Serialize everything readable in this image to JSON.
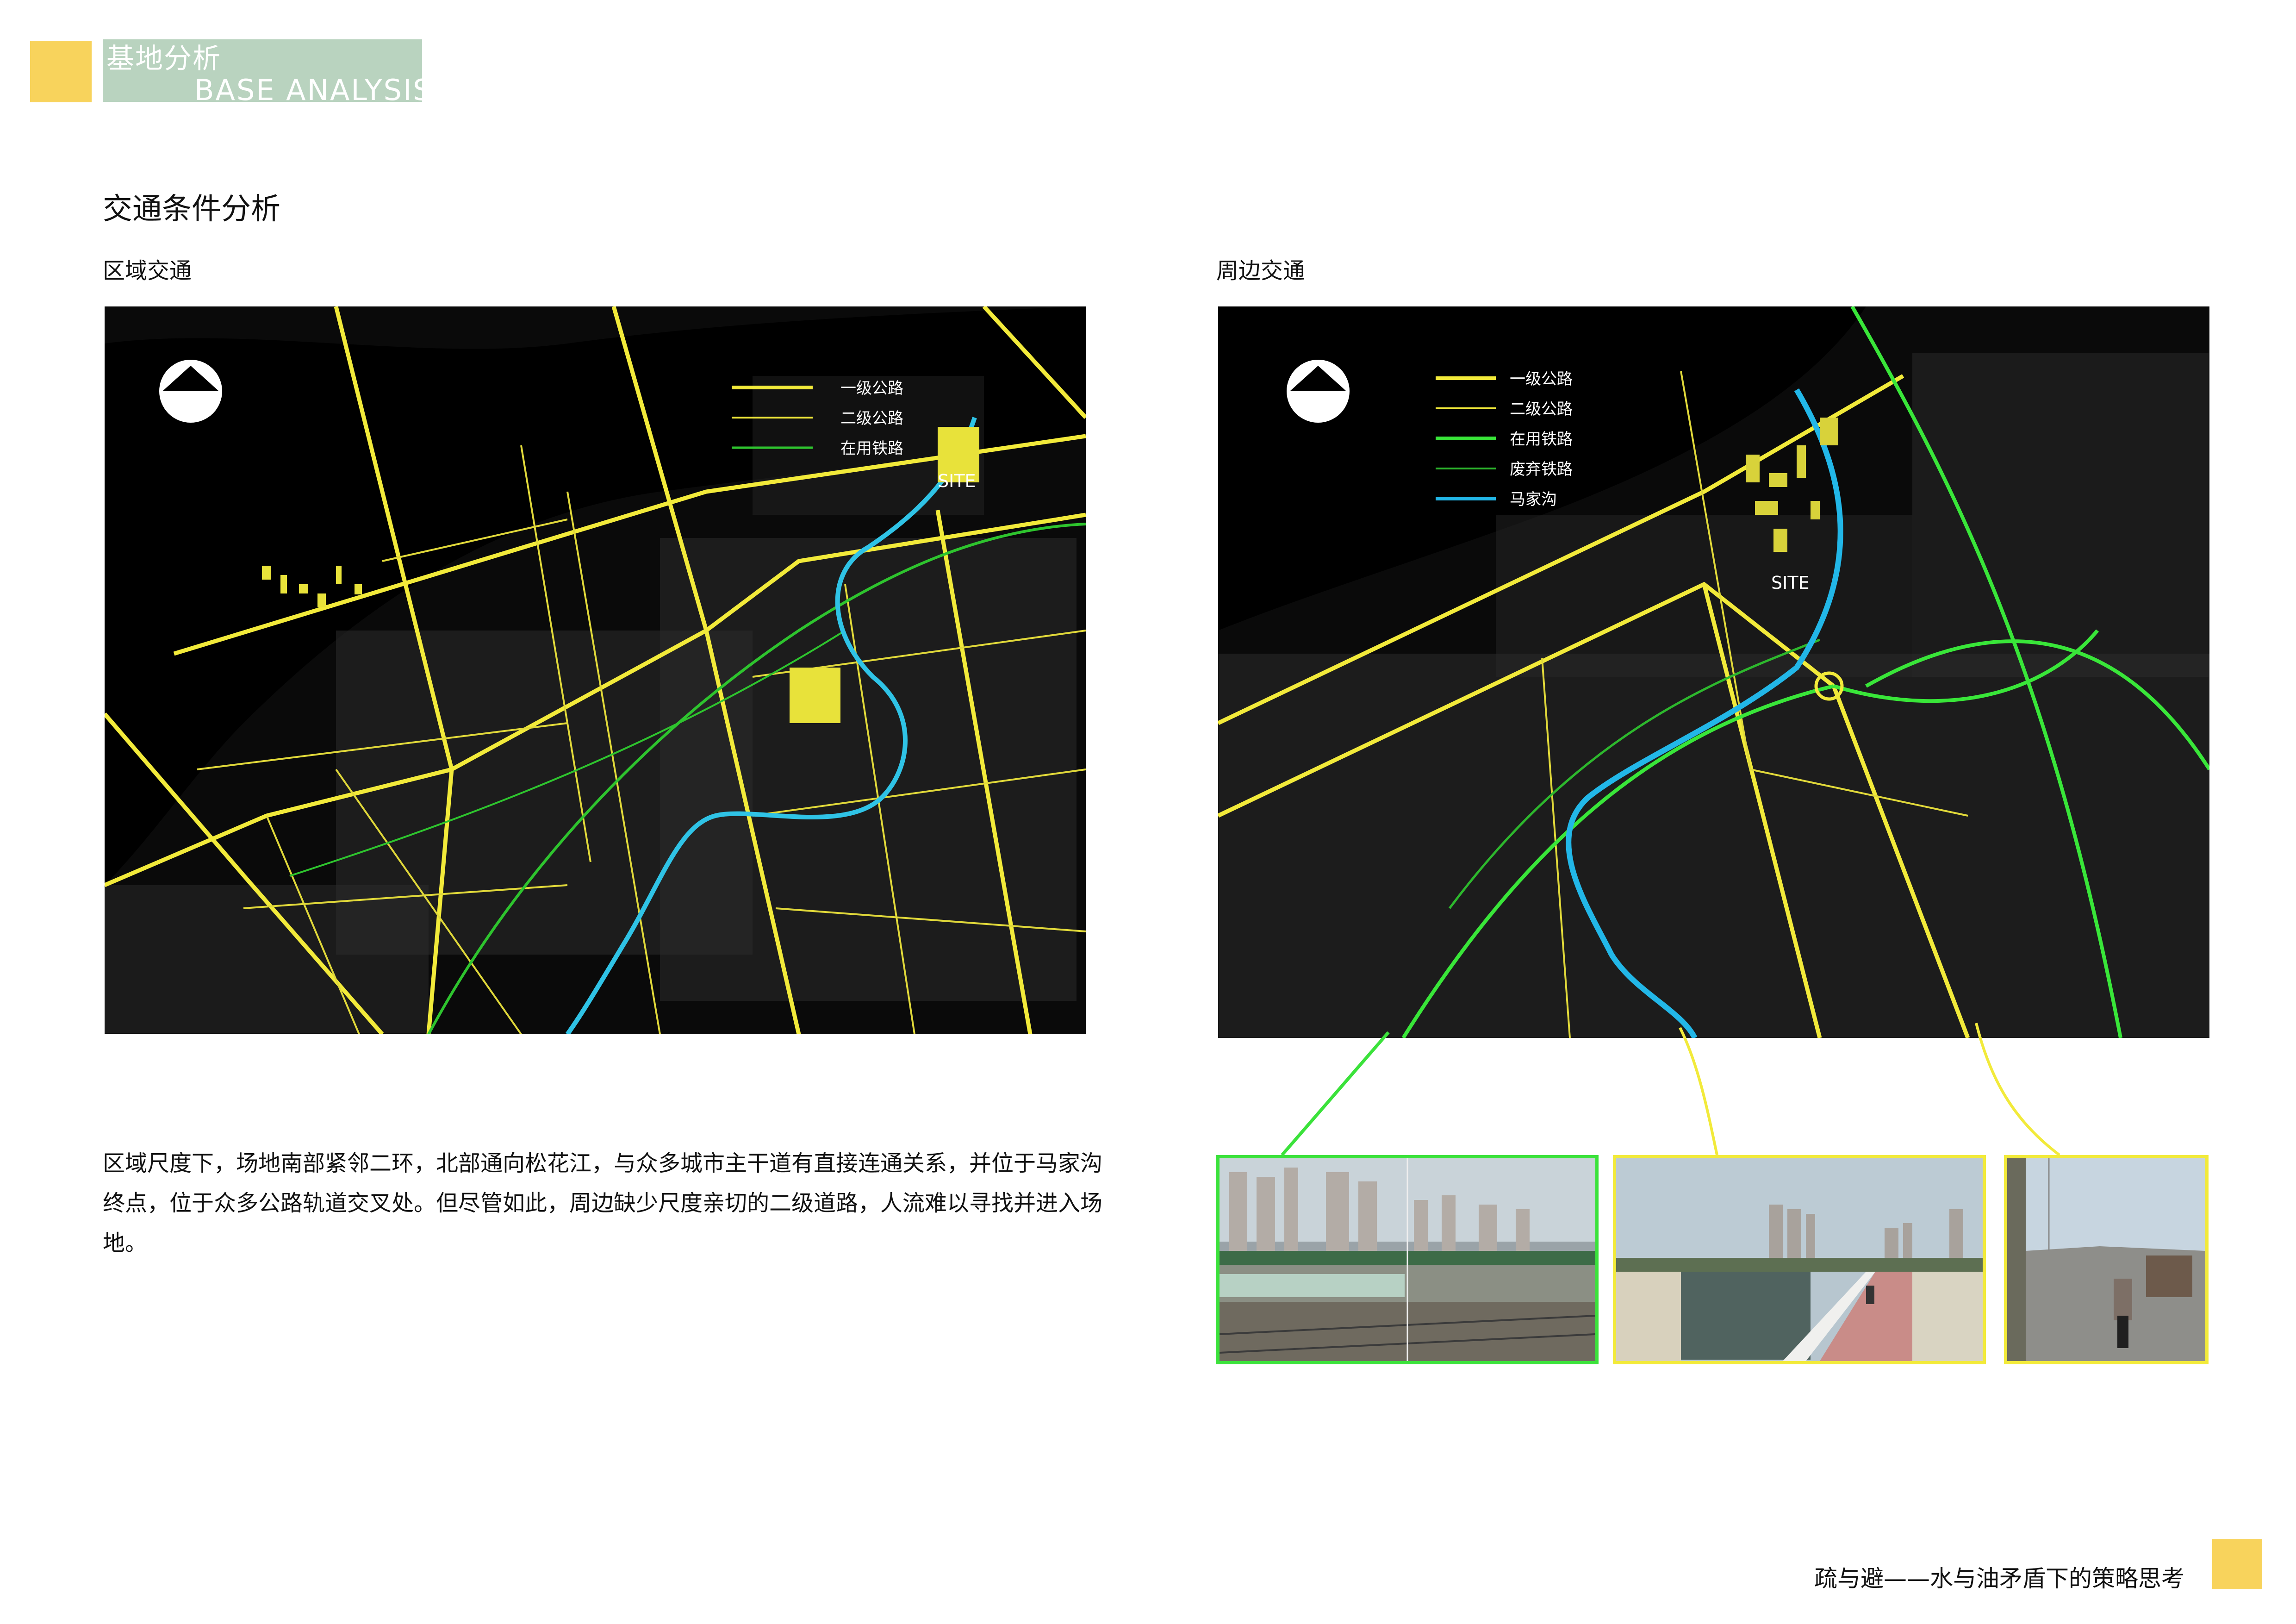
{
  "header": {
    "title_cn": "基地分析",
    "title_en": "BASE ANALYSIS",
    "accent_color": "#F8D35C",
    "band_color": "#B9D3BF"
  },
  "section_title": "交通条件分析",
  "left_panel": {
    "label": "区域交通",
    "site_label": "SITE",
    "north_arrow_icon": "north-arrow-icon",
    "legend": [
      {
        "label": "一级公路",
        "color": "#F2EA3A"
      },
      {
        "label": "二级公路",
        "color": "#F2EA3A"
      },
      {
        "label": "在用铁路",
        "color": "#2EC42E"
      }
    ]
  },
  "right_panel": {
    "label": "周边交通",
    "site_label": "SITE",
    "north_arrow_icon": "north-arrow-icon",
    "legend": [
      {
        "label": "一级公路",
        "color": "#F2EA3A"
      },
      {
        "label": "二级公路",
        "color": "#F2EA3A"
      },
      {
        "label": "在用铁路",
        "color": "#39E639"
      },
      {
        "label": "废弃铁路",
        "color": "#2DB82D"
      },
      {
        "label": "马家沟",
        "color": "#22B7E8"
      }
    ]
  },
  "description": "区域尺度下，场地南部紧邻二环，北部通向松花江，与众多城市主干道有直接连通关系，并位于马家沟终点，位于众多公路轨道交叉处。但尽管如此，周边缺少尺度亲切的二级道路，人流难以寻找并进入场地。",
  "photos": [
    {
      "name": "railway-photo",
      "border_color": "#3BE23B"
    },
    {
      "name": "riverside-path-photo",
      "border_color": "#F2EA3A"
    },
    {
      "name": "road-photo",
      "border_color": "#F2EA3A"
    }
  ],
  "footer": {
    "text": "疏与避——水与油矛盾下的策略思考"
  }
}
